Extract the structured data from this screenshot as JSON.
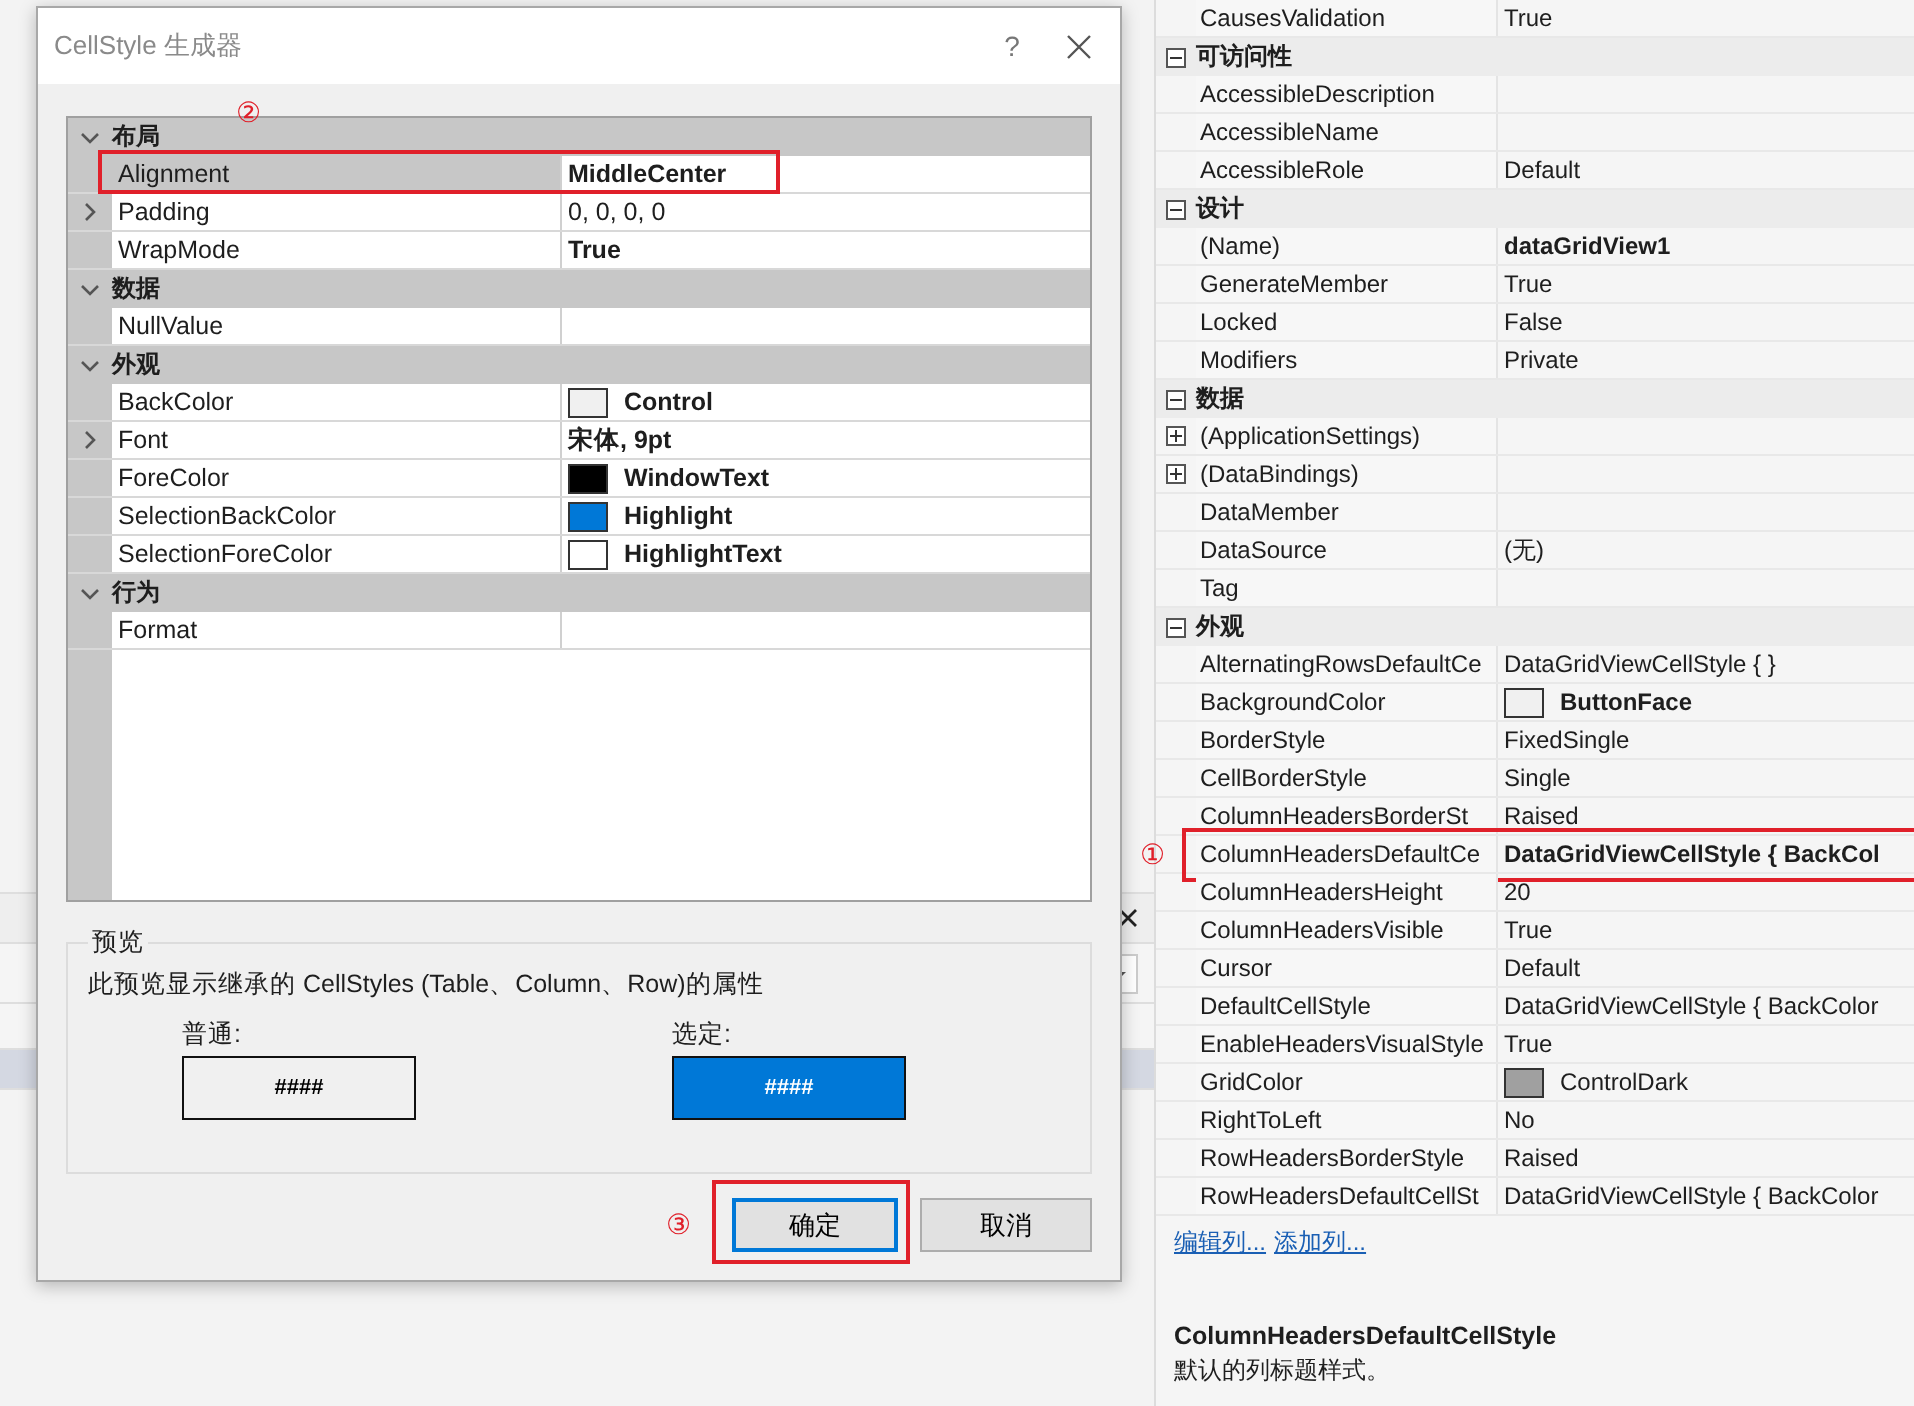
{
  "dialog": {
    "title": "CellStyle 生成器",
    "help": "?",
    "grid": [
      {
        "name": "布局",
        "expanded": true,
        "properties": [
          {
            "name": "Alignment",
            "value": "MiddleCenter",
            "modified": true,
            "selected": true,
            "callout": "②"
          },
          {
            "name": "Padding",
            "value": "0, 0, 0, 0",
            "modified": false,
            "selected": false,
            "expanded": false
          },
          {
            "name": "WrapMode",
            "value": "True",
            "modified": true,
            "selected": false
          }
        ]
      },
      {
        "name": "数据",
        "expanded": true,
        "properties": [
          {
            "name": "NullValue",
            "selected": false
          }
        ]
      },
      {
        "name": "外观",
        "expanded": true,
        "properties": [
          {
            "name": "BackColor",
            "value": "Control",
            "modified": true,
            "selected": false,
            "color": "#f0f0f0"
          },
          {
            "name": "Font",
            "value": "宋体, 9pt",
            "modified": true,
            "selected": false,
            "expanded": false
          },
          {
            "name": "ForeColor",
            "value": "WindowText",
            "modified": true,
            "selected": false,
            "color": "#000000"
          },
          {
            "name": "SelectionBackColor",
            "value": "Highlight",
            "modified": true,
            "selected": false,
            "color": "#0078d7"
          },
          {
            "name": "SelectionForeColor",
            "value": "HighlightText",
            "modified": true,
            "selected": false,
            "color": "#ffffff"
          }
        ]
      },
      {
        "name": "行为",
        "expanded": true,
        "properties": [
          {
            "name": "Format",
            "selected": false
          }
        ]
      }
    ],
    "preview": {
      "title": "预览",
      "description": "此预览显示继承的 CellStyles (Table、Column、Row)的属性",
      "samples": [
        {
          "label": "普通:",
          "text": "####",
          "selected": false
        },
        {
          "label": "选定:",
          "text": "####",
          "selected": true
        }
      ]
    },
    "buttons": [
      {
        "label": "确定",
        "focused": true,
        "callout": "③"
      },
      {
        "label": "取消",
        "focused": false
      }
    ]
  },
  "properties": {
    "categories": [
      {
        "properties": [
          {
            "name": "CausesValidation",
            "value": "True",
            "modified": false
          }
        ]
      },
      {
        "name": "可访问性",
        "expanded": true,
        "properties": [
          {
            "name": "AccessibleDescription"
          },
          {
            "name": "AccessibleName"
          },
          {
            "name": "AccessibleRole",
            "value": "Default",
            "modified": false
          }
        ]
      },
      {
        "name": "设计",
        "expanded": true,
        "properties": [
          {
            "name": "(Name)",
            "value": "dataGridView1",
            "modified": true
          },
          {
            "name": "GenerateMember",
            "value": "True",
            "modified": false
          },
          {
            "name": "Locked",
            "value": "False",
            "modified": false
          },
          {
            "name": "Modifiers",
            "value": "Private",
            "modified": false
          }
        ]
      },
      {
        "name": "数据",
        "expanded": true,
        "properties": [
          {
            "name": "(ApplicationSettings)",
            "expanded": false
          },
          {
            "name": "(DataBindings)",
            "expanded": false
          },
          {
            "name": "DataMember"
          },
          {
            "name": "DataSource",
            "value": "(无)",
            "modified": false
          },
          {
            "name": "Tag"
          }
        ]
      },
      {
        "name": "外观",
        "expanded": true,
        "properties": [
          {
            "name": "AlternatingRowsDefaultCe",
            "value": "DataGridViewCellStyle { }",
            "modified": false
          },
          {
            "name": "BackgroundColor",
            "value": "ButtonFace",
            "modified": true,
            "color": "#f0f0f0"
          },
          {
            "name": "BorderStyle",
            "value": "FixedSingle",
            "modified": false
          },
          {
            "name": "CellBorderStyle",
            "value": "Single",
            "modified": false
          },
          {
            "name": "ColumnHeadersBorderSt",
            "value": "Raised",
            "modified": false
          },
          {
            "name": "ColumnHeadersDefaultCe",
            "value": "DataGridViewCellStyle { BackCol",
            "modified": true,
            "callout": "①"
          },
          {
            "name": "ColumnHeadersHeight",
            "value": "20",
            "modified": false
          },
          {
            "name": "ColumnHeadersVisible",
            "value": "True",
            "modified": false
          },
          {
            "name": "Cursor",
            "value": "Default",
            "modified": false
          },
          {
            "name": "DefaultCellStyle",
            "value": "DataGridViewCellStyle { BackColor",
            "modified": false
          },
          {
            "name": "EnableHeadersVisualStyle",
            "value": "True",
            "modified": false
          },
          {
            "name": "GridColor",
            "value": "ControlDark",
            "modified": false,
            "color": "#a0a0a0"
          },
          {
            "name": "RightToLeft",
            "value": "No",
            "modified": false
          },
          {
            "name": "RowHeadersBorderStyle",
            "value": "Raised",
            "modified": false
          },
          {
            "name": "RowHeadersDefaultCellSt",
            "value": "DataGridViewCellStyle { BackColor",
            "modified": false
          }
        ]
      }
    ],
    "links": [
      "编辑列...",
      "添加列..."
    ],
    "description": {
      "title": "ColumnHeadersDefaultCellStyle",
      "text": "默认的列标题样式。"
    }
  }
}
